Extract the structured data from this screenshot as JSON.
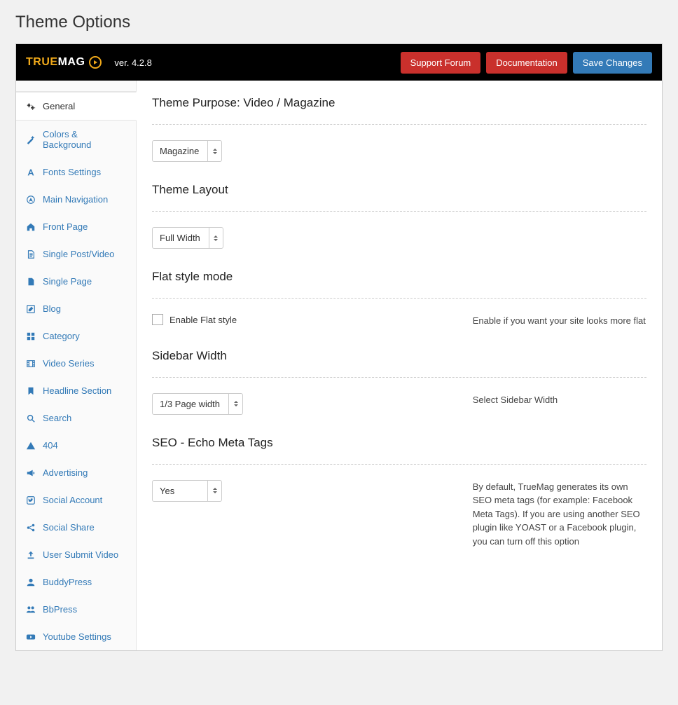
{
  "page_title": "Theme Options",
  "logo": {
    "part1": "TRUE",
    "part2": "MAG"
  },
  "version": "ver. 4.2.8",
  "buttons": {
    "support": "Support Forum",
    "docs": "Documentation",
    "save": "Save Changes"
  },
  "nav": [
    {
      "id": "general",
      "label": "General",
      "active": true
    },
    {
      "id": "colors",
      "label": "Colors & Background"
    },
    {
      "id": "fonts",
      "label": "Fonts Settings"
    },
    {
      "id": "mainnav",
      "label": "Main Navigation"
    },
    {
      "id": "frontpage",
      "label": "Front Page"
    },
    {
      "id": "singlepost",
      "label": "Single Post/Video"
    },
    {
      "id": "singlepage",
      "label": "Single Page"
    },
    {
      "id": "blog",
      "label": "Blog"
    },
    {
      "id": "category",
      "label": "Category"
    },
    {
      "id": "videoseries",
      "label": " Video Series"
    },
    {
      "id": "headline",
      "label": "Headline Section"
    },
    {
      "id": "search",
      "label": "Search"
    },
    {
      "id": "notfound",
      "label": "404"
    },
    {
      "id": "advertising",
      "label": "Advertising"
    },
    {
      "id": "social-account",
      "label": "Social Account"
    },
    {
      "id": "social-share",
      "label": "Social Share"
    },
    {
      "id": "user-submit",
      "label": "User Submit Video"
    },
    {
      "id": "buddypress",
      "label": "BuddyPress"
    },
    {
      "id": "bbpress",
      "label": " BbPress"
    },
    {
      "id": "youtube",
      "label": "Youtube Settings"
    }
  ],
  "sections": {
    "purpose": {
      "title": "Theme Purpose: Video / Magazine",
      "value": "Magazine"
    },
    "layout": {
      "title": "Theme Layout",
      "value": "Full Width"
    },
    "flat": {
      "title": "Flat style mode",
      "checkbox_label": "Enable Flat style",
      "help": "Enable if you want your site looks more flat"
    },
    "sidebar": {
      "title": "Sidebar Width",
      "value": "1/3 Page width",
      "help": "Select Sidebar Width"
    },
    "seo": {
      "title": "SEO - Echo Meta Tags",
      "value": "Yes",
      "help": "By default, TrueMag generates its own SEO meta tags (for example: Facebook Meta Tags). If you are using another SEO plugin like YOAST or a Facebook plugin, you can turn off this option"
    }
  }
}
